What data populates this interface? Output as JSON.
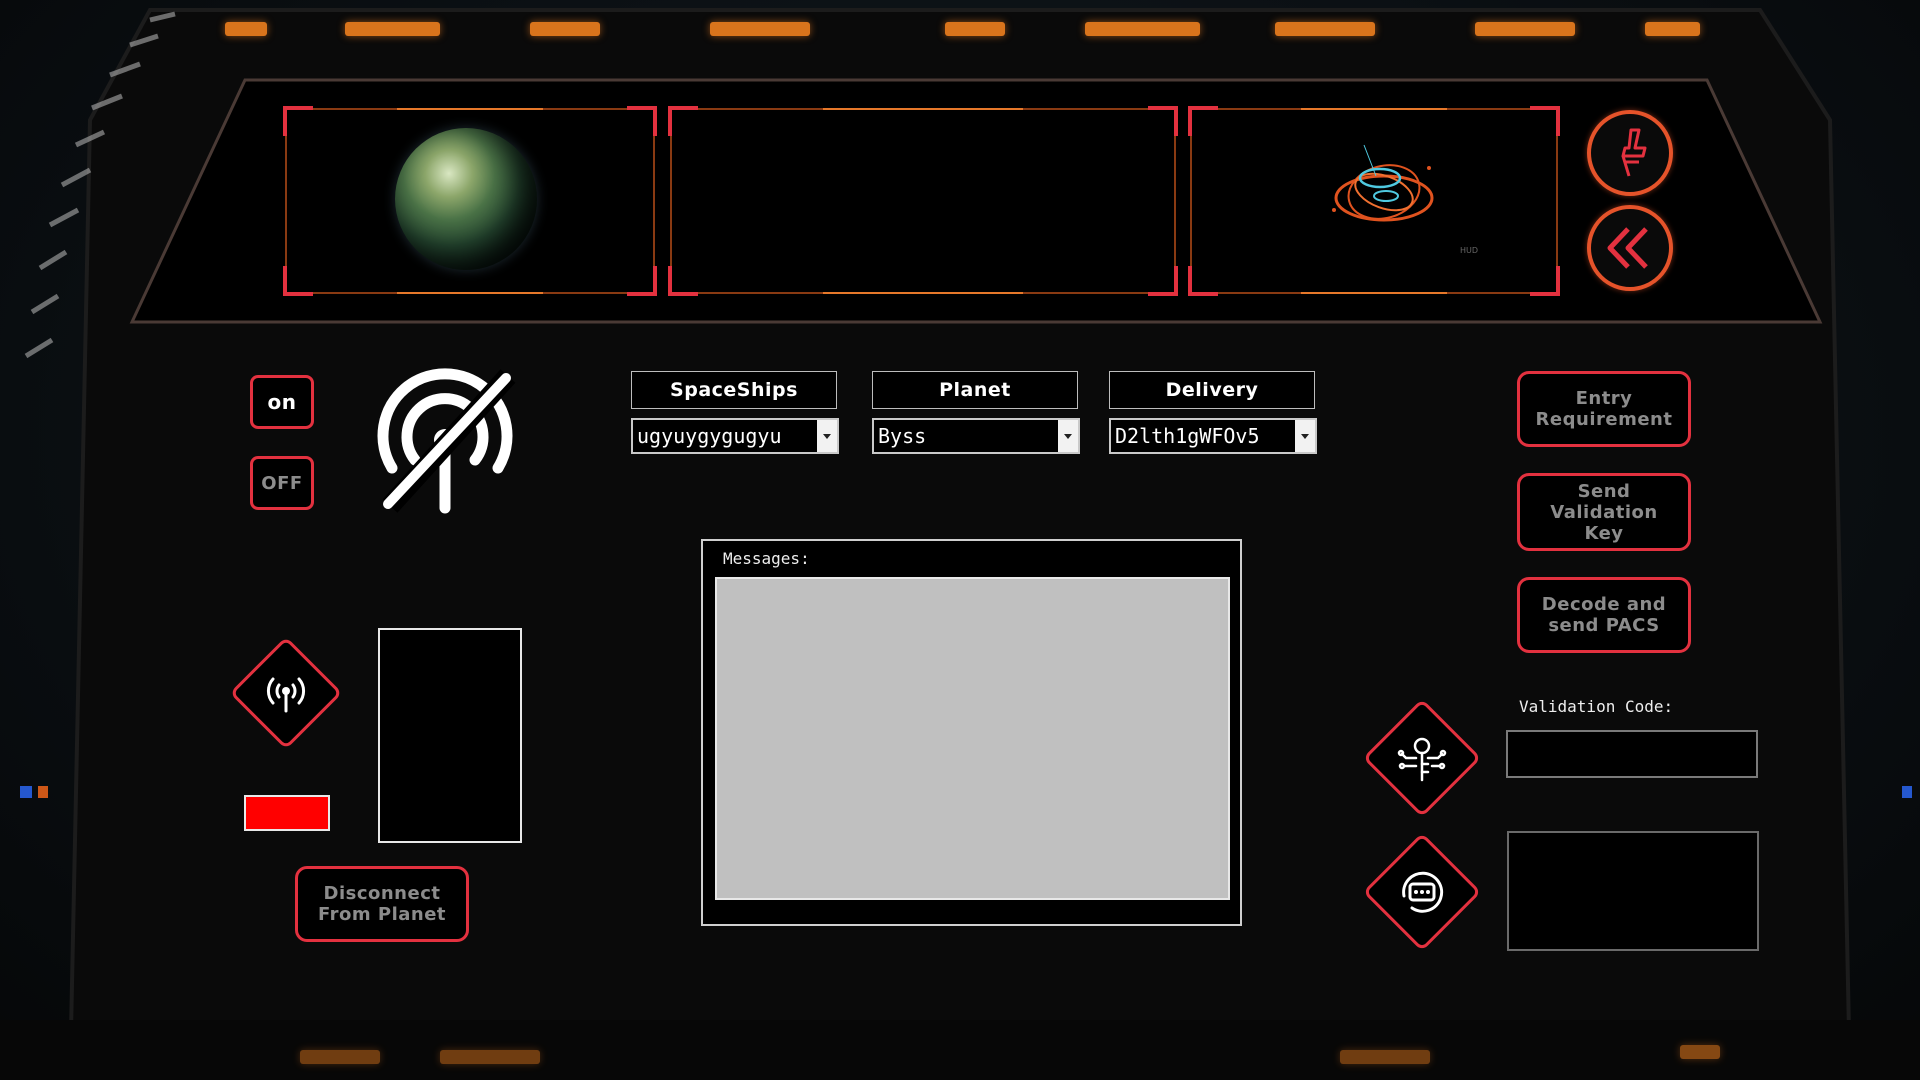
{
  "top_frames": {
    "planet_view_icon": "planet-icon",
    "center_view_icon": "",
    "hologram_view_icon": "hologram-icon",
    "hologram_label": "HUD"
  },
  "side_buttons": {
    "seat_icon": "seat-icon",
    "back_icon": "double-chevron-left-icon"
  },
  "power": {
    "on_label": "on",
    "off_label": "OFF"
  },
  "signal_icon": "signal-off-icon",
  "selectors": {
    "spaceships": {
      "header": "SpaceShips",
      "value": "ugyuygygugyu"
    },
    "planet": {
      "header": "Planet",
      "value": "Byss"
    },
    "delivery": {
      "header": "Delivery",
      "value": "D2lth1gWFOv5"
    }
  },
  "messages": {
    "label": "Messages:",
    "content": ""
  },
  "right_buttons": {
    "entry_requirement": "Entry Requirement",
    "send_validation_key": "Send Validation Key",
    "decode_and_send": "Decode and send PACS"
  },
  "validation": {
    "label": "Validation Code:",
    "value": ""
  },
  "left_panel": {
    "broadcast_icon": "broadcast-icon",
    "status_color": "#ff0000",
    "disconnect_label": "Disconnect From Planet"
  },
  "diamond_buttons": {
    "key_icon": "circuit-key-icon",
    "chat_icon": "chat-icon"
  },
  "colors": {
    "accent_red": "#e3313f",
    "accent_orange": "#e5532a",
    "button_text": "#8c8c8c"
  }
}
